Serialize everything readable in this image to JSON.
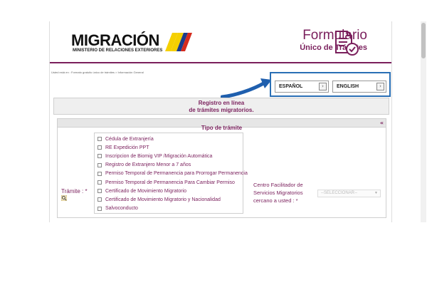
{
  "header": {
    "logo_text": "MIGRACIÓN",
    "logo_subtitle": "MINISTERIO DE RELACIONES EXTERIORES",
    "form_title_line1": "Formulario",
    "form_title_line2": "Único de Trámites"
  },
  "breadcrumb": "Usted está en : Formato gratuito único de trámites > Información General",
  "language": {
    "spanish_label": "ESPAÑOL",
    "english_label": "ENGLISH",
    "arrow_glyph": "›"
  },
  "title": {
    "line1": "Registro en línea",
    "line2": "de trámites migratorios."
  },
  "panel": {
    "heading": "Tipo de trámite",
    "collapse_glyph": "«"
  },
  "tramite": {
    "label": "Trámite : *",
    "options": [
      "Cédula de Extranjería",
      "RE Expedición PPT",
      "Inscripcion de Biomig VIP /Migración Automática",
      "Registro de Extranjero Menor a 7 años",
      "Permiso Temporal de Permanencia para Prorrogar Permanencia",
      "Permiso Temporal de Permanencia Para Cambiar Permiso",
      "Certificado de Movimiento Migratorio",
      "Certificado de Movimiento Migratorio y Nacionalidad",
      "Salvoconducto"
    ]
  },
  "centro": {
    "label_line1": "Centro Facilitador de",
    "label_line2": "Servicios Migratorios",
    "label_line3": "cercano a usted : *",
    "select_value": "--SELECCIONAR--"
  },
  "colors": {
    "brand": "#7a1f5c",
    "highlight_border": "#2a6fb5"
  }
}
